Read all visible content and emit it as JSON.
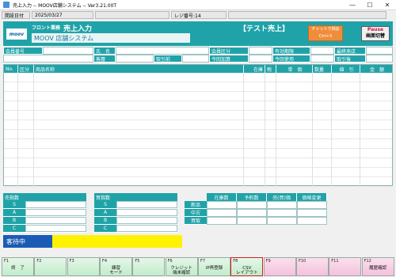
{
  "window": {
    "title": "売上入力 -- MOOV店舗システム -- Ver3.21.00T",
    "controls": {
      "minimize": "—",
      "maximize": "☐",
      "close": "✕"
    }
  },
  "infobar": {
    "open_date_label": "開設日付",
    "open_date_value": "2025/03/27",
    "register_label": "レジ番号:14"
  },
  "header": {
    "logo": "moov",
    "department": "フロント業務",
    "screen_title": "売上入力",
    "system_name": "MOOV 店舗システム",
    "test_label": "【テスト売上】",
    "chat_button": {
      "line1": "チャットで相談",
      "line2": "Ctrl+S"
    },
    "pause_button": {
      "line1": "Pause",
      "line2": "画面切替"
    }
  },
  "customer": {
    "member_no": "会員番号",
    "name": "氏　名",
    "customer_tier": "客層",
    "past_transactions": "取引前",
    "member_class": "会員区分",
    "points_this_time": "今回加算",
    "expiry": "有効期限",
    "points_used": "今回使用",
    "last_visit": "最終来店",
    "after_transaction": "取引後"
  },
  "items_table": {
    "columns": [
      "No.",
      "区分",
      "商品名称",
      "在庫",
      "税",
      "単　価",
      "数量",
      "値　引",
      "金　額"
    ]
  },
  "panels": {
    "sales_count": {
      "title": "売指数",
      "rows": [
        "S",
        "A",
        "B",
        "C"
      ]
    },
    "purchase_count": {
      "title": "買指数",
      "rows": [
        "S",
        "A",
        "B",
        "C"
      ]
    }
  },
  "stock": {
    "columns": [
      "在庫数",
      "予約数",
      "売(買)価",
      "価格変更"
    ],
    "rows": [
      "新品",
      "中古",
      "買取"
    ]
  },
  "hold": {
    "label": "客待中"
  },
  "function_keys": [
    {
      "key": "F1",
      "label": "終　了",
      "style": "green"
    },
    {
      "key": "F2",
      "label": "",
      "style": "green"
    },
    {
      "key": "F3",
      "label": "",
      "style": "green"
    },
    {
      "key": "F4",
      "label": "練習\nモード",
      "style": "green"
    },
    {
      "key": "F5",
      "label": "",
      "style": "green"
    },
    {
      "key": "F6",
      "label": "クレジット\n端末確認",
      "style": "green"
    },
    {
      "key": "F7",
      "label": "IP再登録",
      "style": "green"
    },
    {
      "key": "F8",
      "label": "CSV\nレイアウト",
      "style": "green",
      "selected": true
    },
    {
      "key": "F9",
      "label": "",
      "style": "pink"
    },
    {
      "key": "F10",
      "label": "",
      "style": "pink"
    },
    {
      "key": "F11",
      "label": "",
      "style": "pink"
    },
    {
      "key": "F12",
      "label": "履歴確認",
      "style": "pink"
    }
  ]
}
